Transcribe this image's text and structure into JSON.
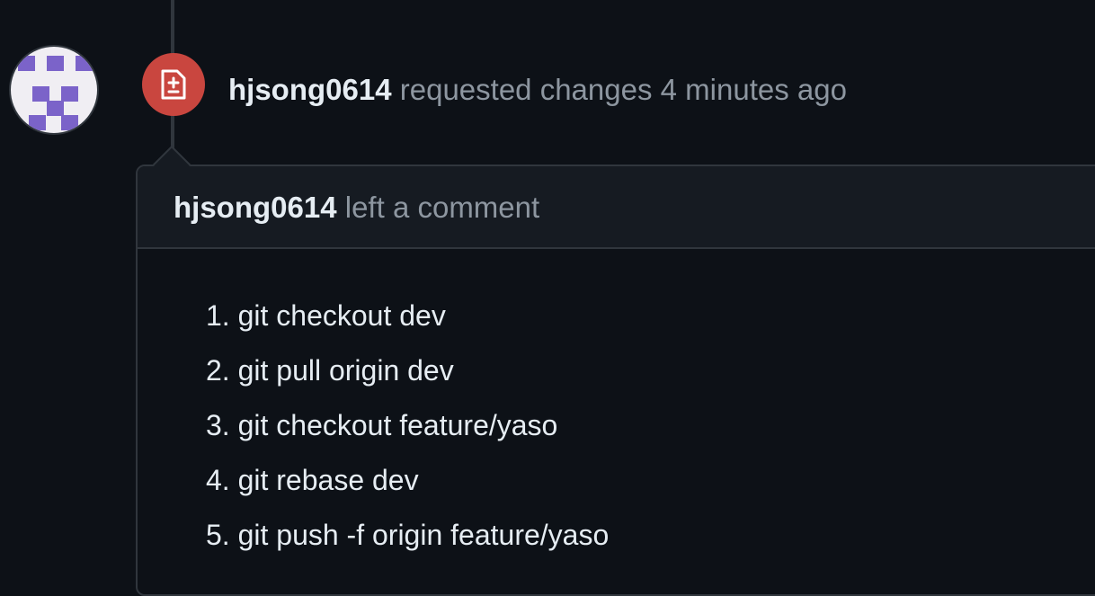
{
  "event": {
    "author": "hjsong0614",
    "action": "requested changes",
    "time": "4 minutes ago",
    "icon": "file-diff-icon",
    "badge_color": "#c9463f"
  },
  "comment": {
    "author": "hjsong0614",
    "header_text": "left a comment",
    "steps": [
      "1. git checkout dev",
      "2. git pull origin dev",
      "3. git checkout feature/yaso",
      "4. git rebase dev",
      "5. git push -f origin feature/yaso"
    ]
  },
  "avatar": {
    "accent": "#7b63c9",
    "background": "#f0eef3"
  }
}
